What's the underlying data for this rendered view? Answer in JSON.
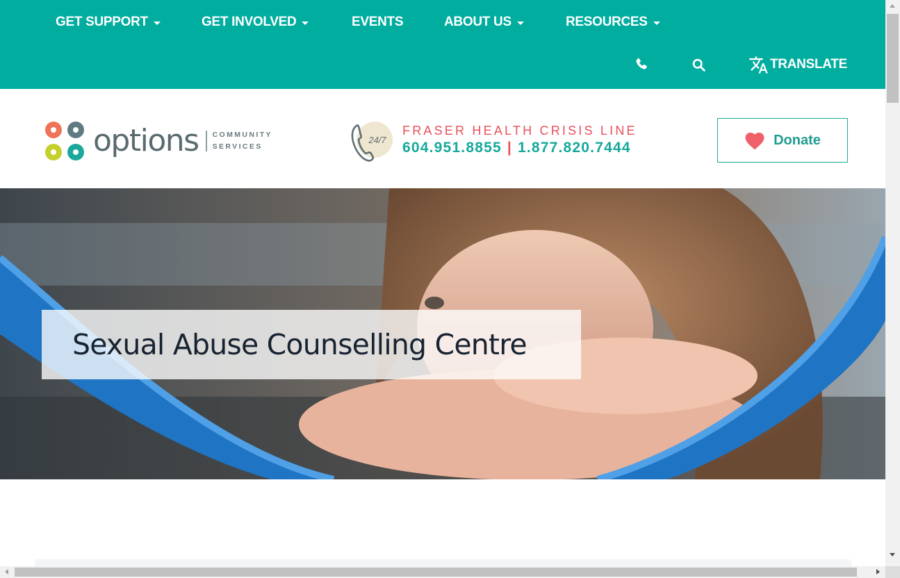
{
  "nav": {
    "items": [
      {
        "label": "GET SUPPORT",
        "dropdown": true
      },
      {
        "label": "GET INVOLVED",
        "dropdown": true
      },
      {
        "label": "EVENTS",
        "dropdown": false
      },
      {
        "label": "ABOUT US",
        "dropdown": true
      },
      {
        "label": "RESOURCES",
        "dropdown": true
      }
    ],
    "translate_label": "TRANSLATE",
    "icons": [
      "phone-icon",
      "search-icon",
      "translate-icon"
    ],
    "background_color": "#00ad9f"
  },
  "header": {
    "logo": {
      "wordmark": "options",
      "sub_line1": "COMMUNITY",
      "sub_line2": "SERVICES"
    },
    "crisis": {
      "badge": "24/7",
      "title": "FRASER HEALTH CRISIS LINE",
      "phone1": "604.951.8855",
      "separator": "|",
      "phone2": "1.877.820.7444"
    },
    "donate_label": "Donate"
  },
  "hero": {
    "title": "Sexual Abuse Counselling Centre"
  },
  "colors": {
    "teal": "#00ad9f",
    "coral": "#e8515b",
    "heart": "#f0606a",
    "dark_text": "#182331"
  }
}
